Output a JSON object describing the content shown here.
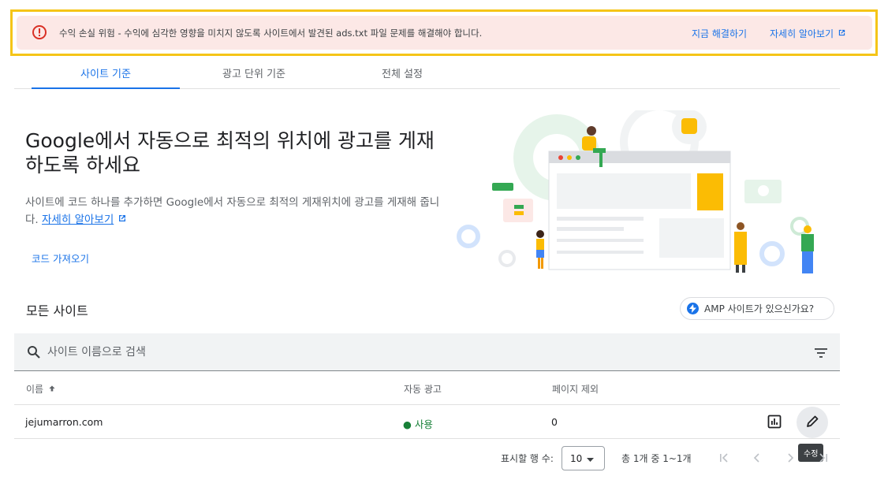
{
  "alert": {
    "message": "수익 손실 위험 - 수익에 심각한 영향을 미치지 않도록 사이트에서 발견된 ads.txt 파일 문제를 해결해야 합니다.",
    "fix_now": "지금 해결하기",
    "learn_more": "자세히 알아보기",
    "color": "#fce8e6",
    "icon": "error-icon"
  },
  "tabs": [
    {
      "label": "사이트 기준",
      "active": true
    },
    {
      "label": "광고 단위 기준",
      "active": false
    },
    {
      "label": "전체 설정",
      "active": false
    }
  ],
  "hero": {
    "title": "Google에서 자동으로 최적의 위치에 광고를 게재하도록 하세요",
    "description": "사이트에 코드 하나를 추가하면 Google에서 자동으로 최적의 게재위치에 광고를 게재해 줍니다.",
    "learn_more": "자세히 알아보기",
    "get_code": "코드 가져오기"
  },
  "sites": {
    "heading": "모든 사이트",
    "amp_chip": "AMP 사이트가 있으신가요?",
    "search_placeholder": "사이트 이름으로 검색",
    "columns": {
      "name": "이름",
      "auto_ads": "자동 광고",
      "excluded_pages": "페이지 제외"
    },
    "rows": [
      {
        "name": "jejumarron.com",
        "auto_ads": "● 사용",
        "excluded_pages": "0"
      }
    ],
    "edit_tooltip": "수정"
  },
  "pagination": {
    "rows_label": "표시할 행 수:",
    "rows_value": "10",
    "range": "총 1개 중 1~1개"
  },
  "colors": {
    "accent": "#1a73e8",
    "status_on": "#188038",
    "highlight_frame": "#f5c518"
  }
}
